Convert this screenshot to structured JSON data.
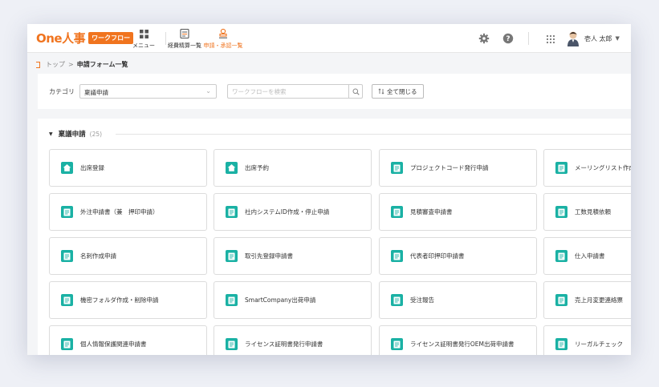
{
  "header": {
    "logo_text": "One人事",
    "logo_badge": "ワークフロー",
    "nav": {
      "menu_label": "メニュー",
      "expense_label": "経費精算一覧",
      "approval_label": "申請・承認一覧"
    },
    "user_name": "壱人 太郎"
  },
  "breadcrumb": {
    "home": "トップ",
    "separator": ">",
    "current": "申請フォーム一覧"
  },
  "filter": {
    "category_label": "カテゴリ",
    "category_value": "稟議申請",
    "search_placeholder": "ワークフローを検索",
    "collapse_label": "全て閉じる"
  },
  "group": {
    "title": "稟議申請",
    "count": "(25)"
  },
  "cards": [
    {
      "label": "出席登録",
      "icon": "home-icon"
    },
    {
      "label": "出席予約",
      "icon": "home-icon"
    },
    {
      "label": "プロジェクトコード発行申請",
      "icon": "document-icon"
    },
    {
      "label": "メーリングリスト作成申請",
      "icon": "document-icon"
    },
    {
      "label": "外注申請書（兼　押印申請）",
      "icon": "document-icon"
    },
    {
      "label": "社内システムID作成・停止申請",
      "icon": "document-icon"
    },
    {
      "label": "見積審査申請書",
      "icon": "document-icon"
    },
    {
      "label": "工数見積依頼",
      "icon": "document-icon"
    },
    {
      "label": "名刺作成申請",
      "icon": "document-icon"
    },
    {
      "label": "取引先登録申請書",
      "icon": "document-icon"
    },
    {
      "label": "代表者印押印申請書",
      "icon": "document-icon"
    },
    {
      "label": "仕入申請書",
      "icon": "document-icon"
    },
    {
      "label": "機密フォルダ作成・削除申請",
      "icon": "document-icon"
    },
    {
      "label": "SmartCompany出荷申請",
      "icon": "document-icon"
    },
    {
      "label": "受注報告",
      "icon": "document-icon"
    },
    {
      "label": "売上月変更連絡票",
      "icon": "document-icon"
    },
    {
      "label": "個人情報保護関連申請書",
      "icon": "document-icon"
    },
    {
      "label": "ライセンス証明書発行申請書",
      "icon": "document-icon"
    },
    {
      "label": "ライセンス証明書発行OEM出荷申請書",
      "icon": "document-icon"
    },
    {
      "label": "リーガルチェック",
      "icon": "document-icon"
    }
  ],
  "colors": {
    "brand": "#f0741f",
    "card_icon": "#1ab1a4"
  }
}
